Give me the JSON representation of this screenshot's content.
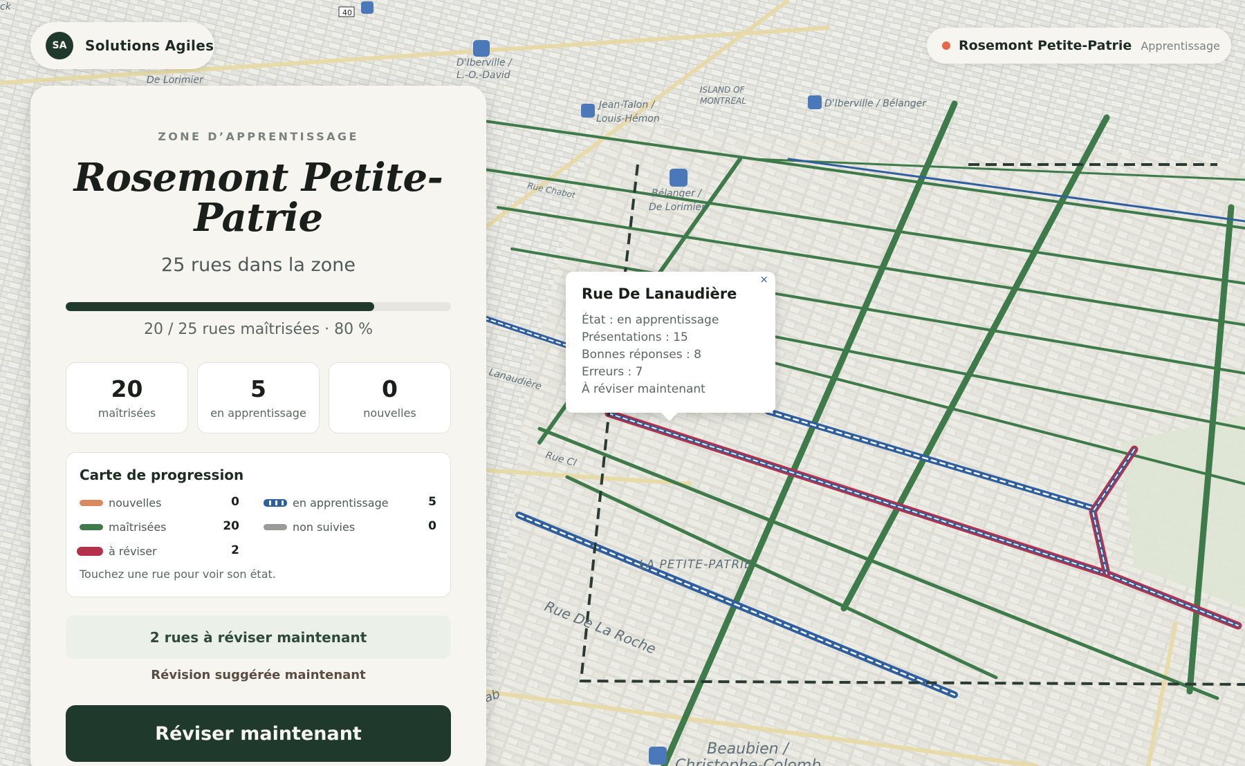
{
  "brand": {
    "initials": "SA",
    "name": "Solutions Agiles"
  },
  "zone_pill": {
    "name": "Rosemont Petite-Patrie",
    "mode": "Apprentissage",
    "dot_color": "#e4684c"
  },
  "panel": {
    "eyebrow": "ZONE D’APPRENTISSAGE",
    "title": "Rosemont Petite-Patrie",
    "street_count": "25 rues dans la zone",
    "progress_fraction": 0.8,
    "progress_text": "20 / 25 rues maîtrisées · 80 %",
    "stats": [
      {
        "value": "20",
        "label": "maîtrisées"
      },
      {
        "value": "5",
        "label": "en apprentissage"
      },
      {
        "value": "0",
        "label": "nouvelles"
      }
    ],
    "legend": {
      "title": "Carte de progression",
      "items": [
        {
          "label": "nouvelles",
          "value": "0",
          "color": "#d9895b"
        },
        {
          "label": "en apprentissage",
          "value": "5",
          "color": "#2f5f9e"
        },
        {
          "label": "maîtrisées",
          "value": "20",
          "color": "#3f7a4a"
        },
        {
          "label": "non suivies",
          "value": "0",
          "color": "#9a9a98"
        },
        {
          "label": "à réviser",
          "value": "2",
          "color": "#b5304a"
        }
      ],
      "hint": "Touchez une rue pour voir son état."
    },
    "review_banner": "2 rues à réviser maintenant",
    "review_hint": "Révision suggérée maintenant",
    "cta": "Réviser maintenant"
  },
  "popup": {
    "close": "×",
    "title": "Rue De Lanaudière",
    "lines": [
      "État : en apprentissage",
      "Présentations : 15",
      "Bonnes réponses : 8",
      "Erreurs : 7",
      "À réviser maintenant"
    ]
  },
  "map_labels": {
    "ck": "ck",
    "route": "40",
    "delorimier_top": "De Lorimier",
    "diberville_lo": "D'Iberville /",
    "diberville_lo2": "L.-O.-David",
    "jeantalon": "Jean-Talon /",
    "jeantalon2": "Louis-Hémon",
    "island": "ISLAND OF",
    "island2": "MONTREAL",
    "diberville_bel": "D'Iberville / Bélanger",
    "belanger": "Bélanger /",
    "belanger2": "De Lorimier",
    "rue_chabot": "Rue Chabot",
    "lanaudiere": "Lanaudière",
    "rue_cl": "Rue Cl",
    "petite_patrie": "LA PETITE-PATRIE",
    "rue_laroche": "Rue De La Roche",
    "ab": "ab",
    "beaubien": "Beaubien /",
    "colomb": "Christophe-Colomb"
  },
  "colors": {
    "mastered": "#3f7a4a",
    "learning": "#2f5f9e",
    "review": "#b5304a",
    "new": "#d9895b",
    "untracked": "#9a9a98",
    "accent_dark": "#1f3a2d"
  }
}
